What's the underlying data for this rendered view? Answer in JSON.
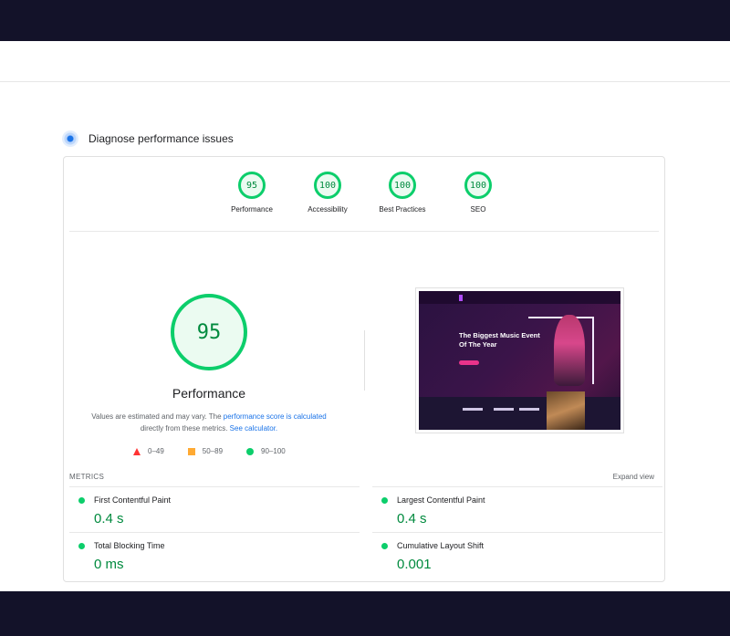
{
  "diagnose": {
    "title": "Diagnose performance issues"
  },
  "scores": [
    {
      "value": "95",
      "label": "Performance"
    },
    {
      "value": "100",
      "label": "Accessibility"
    },
    {
      "value": "100",
      "label": "Best Practices"
    },
    {
      "value": "100",
      "label": "SEO"
    }
  ],
  "main": {
    "score": "95",
    "label": "Performance",
    "note_prefix": "Values are estimated and may vary. The ",
    "note_link1": "performance score is calculated",
    "note_mid": "directly from these metrics. ",
    "note_link2": "See calculator."
  },
  "legend": [
    {
      "range": "0–49",
      "color": "#ff3333"
    },
    {
      "range": "50–89",
      "color": "#ffaa33"
    },
    {
      "range": "90–100",
      "color": "#0cce6b"
    }
  ],
  "screenshot": {
    "headline": "The Biggest Music Event Of The Year"
  },
  "metrics": {
    "header": "METRICS",
    "expand": "Expand view",
    "items": [
      {
        "name": "First Contentful Paint",
        "value": "0.4 s"
      },
      {
        "name": "Largest Contentful Paint",
        "value": "0.4 s"
      },
      {
        "name": "Total Blocking Time",
        "value": "0 ms"
      },
      {
        "name": "Cumulative Layout Shift",
        "value": "0.001"
      }
    ]
  },
  "colors": {
    "good": "#0cce6b",
    "good_text": "#008a3e",
    "link": "#1a73e8",
    "dark_bar": "#131229"
  }
}
